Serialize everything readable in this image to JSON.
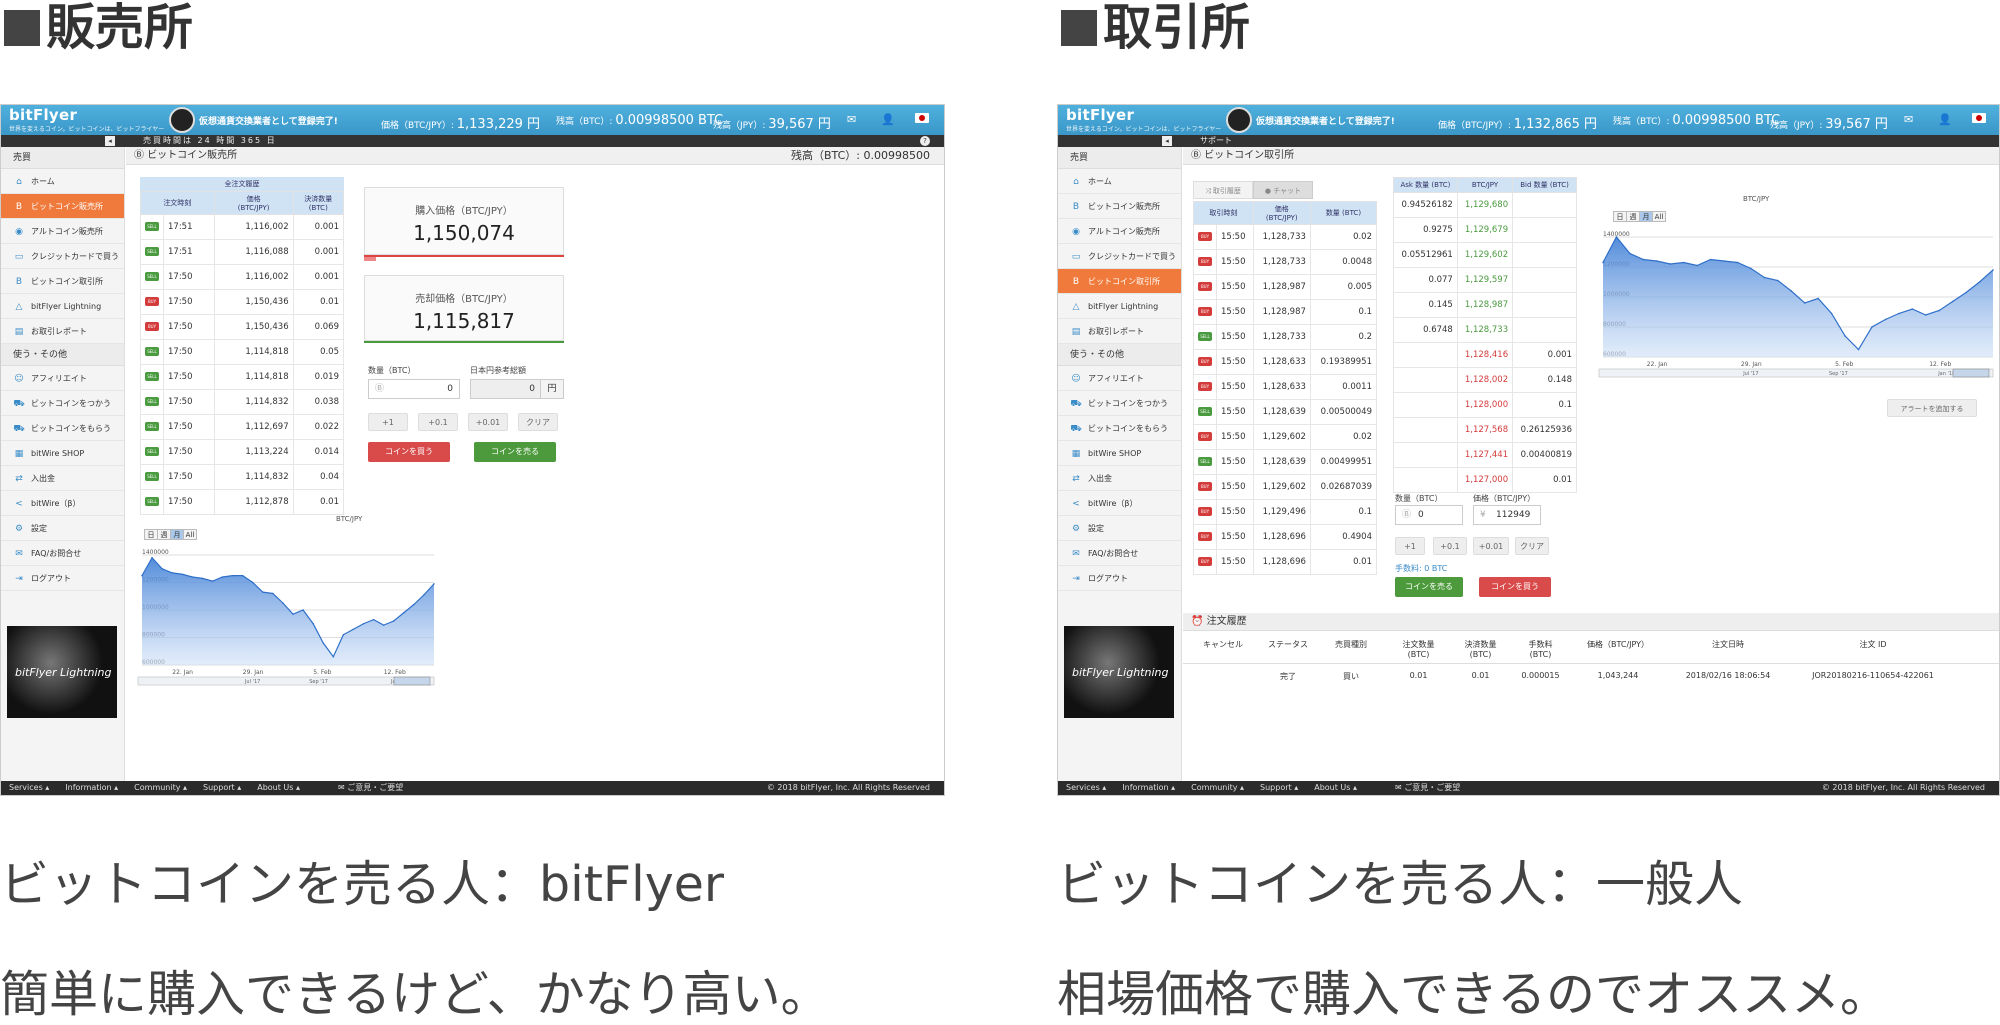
{
  "left": {
    "heading": "販売所",
    "caption1": "ビットコインを売る人：bitFlyer",
    "caption2": "簡単に購入できるけど、かなり高い。",
    "app": {
      "logo": "bitFlyer",
      "tagline": "世界を変えるコイン。ビットコインは、ビットフライヤー",
      "registered": "仮想通貨交換業者として登録完了!",
      "price_label": "価格（BTC/JPY）:",
      "price": "1,133,229 円",
      "btc_label": "残高（BTC）:",
      "btc": "0.00998500 BTC",
      "jpy_label": "残高（JPY）:",
      "jpy": "39,567 円",
      "notice": "売買時間は 24 時間 365 日",
      "page_title": "ビットコイン販売所",
      "balance": "残高（BTC）: 0.00998500"
    },
    "sidebar": {
      "section1": "売買",
      "items1": [
        {
          "label": "ホーム",
          "icon": "⌂"
        },
        {
          "label": "ビットコイン販売所",
          "icon": "B",
          "active": true
        },
        {
          "label": "アルトコイン販売所",
          "icon": "◉"
        },
        {
          "label": "クレジットカードで買う",
          "icon": "▭"
        },
        {
          "label": "ビットコイン取引所",
          "icon": "B"
        },
        {
          "label": "bitFlyer Lightning",
          "icon": "△"
        },
        {
          "label": "お取引レポート",
          "icon": "▤"
        }
      ],
      "section2": "使う・その他",
      "items2": [
        {
          "label": "アフィリエイト",
          "icon": "☺"
        },
        {
          "label": "ビットコインをつかう",
          "icon": "⛟"
        },
        {
          "label": "ビットコインをもらう",
          "icon": "⛟"
        },
        {
          "label": "bitWire SHOP",
          "icon": "▦"
        },
        {
          "label": "入出金",
          "icon": "⇄"
        },
        {
          "label": "bitWire（β）",
          "icon": "<"
        },
        {
          "label": "設定",
          "icon": "⚙"
        },
        {
          "label": "FAQ/お問合せ",
          "icon": "✉"
        },
        {
          "label": "ログアウト",
          "icon": "⇥"
        }
      ],
      "banner": "bitFlyer Lightning"
    },
    "trades": {
      "title": "全注文履歴",
      "headers": [
        "注文時刻",
        "価格\n(BTC/JPY)",
        "決済数量\n(BTC)"
      ],
      "rows": [
        {
          "side": "SELL",
          "time": "17:51",
          "price": "1,116,002",
          "qty": "0.001"
        },
        {
          "side": "SELL",
          "time": "17:51",
          "price": "1,116,088",
          "qty": "0.001"
        },
        {
          "side": "SELL",
          "time": "17:50",
          "price": "1,116,002",
          "qty": "0.001"
        },
        {
          "side": "BUY",
          "time": "17:50",
          "price": "1,150,436",
          "qty": "0.01"
        },
        {
          "side": "BUY",
          "time": "17:50",
          "price": "1,150,436",
          "qty": "0.069"
        },
        {
          "side": "SELL",
          "time": "17:50",
          "price": "1,114,818",
          "qty": "0.05"
        },
        {
          "side": "SELL",
          "time": "17:50",
          "price": "1,114,818",
          "qty": "0.019"
        },
        {
          "side": "SELL",
          "time": "17:50",
          "price": "1,114,832",
          "qty": "0.038"
        },
        {
          "side": "SELL",
          "time": "17:50",
          "price": "1,112,697",
          "qty": "0.022"
        },
        {
          "side": "SELL",
          "time": "17:50",
          "price": "1,113,224",
          "qty": "0.014"
        },
        {
          "side": "SELL",
          "time": "17:50",
          "price": "1,114,832",
          "qty": "0.04"
        },
        {
          "side": "SELL",
          "time": "17:50",
          "price": "1,112,878",
          "qty": "0.01"
        }
      ]
    },
    "buy_price_label": "購入価格（BTC/JPY）",
    "buy_price": "1,150,074",
    "sell_price_label": "売却価格（BTC/JPY）",
    "sell_price": "1,115,817",
    "qty_label": "数量（BTC）",
    "qty_value": "0",
    "yen_label": "日本円参考総額",
    "yen_value": "0",
    "yen_unit": "円",
    "steps": [
      "+1",
      "+0.1",
      "+0.01",
      "クリア"
    ],
    "buy_button": "コインを買う",
    "sell_button": "コインを売る",
    "chart_title": "BTC/JPY",
    "ranges": [
      "日",
      "週",
      "月",
      "All"
    ],
    "yticks": [
      "1400000",
      "1200000",
      "1000000",
      "800000",
      "600000"
    ],
    "xticks": [
      "22. Jan",
      "29. Jan",
      "5. Feb",
      "12. Feb"
    ],
    "nav_labels": [
      "Jul '17",
      "Sep '17",
      "Jan '18"
    ]
  },
  "right": {
    "heading": "取引所",
    "caption1": "ビットコインを売る人：一般人",
    "caption2": "相場価格で購入できるのでオススメ。",
    "app": {
      "price": "1,132,865 円",
      "page_title": "ビットコイン取引所",
      "support": "サポート"
    },
    "tabs": [
      "取引履歴",
      "チャット"
    ],
    "trades": {
      "headers": [
        "取引時刻",
        "価格\n(BTC/JPY)",
        "数量 (BTC)"
      ],
      "rows": [
        {
          "side": "BUY",
          "time": "15:50",
          "price": "1,128,733",
          "qty": "0.02"
        },
        {
          "side": "BUY",
          "time": "15:50",
          "price": "1,128,733",
          "qty": "0.0048"
        },
        {
          "side": "BUY",
          "time": "15:50",
          "price": "1,128,987",
          "qty": "0.005"
        },
        {
          "side": "BUY",
          "time": "15:50",
          "price": "1,128,987",
          "qty": "0.1"
        },
        {
          "side": "SELL",
          "time": "15:50",
          "price": "1,128,733",
          "qty": "0.2"
        },
        {
          "side": "BUY",
          "time": "15:50",
          "price": "1,128,633",
          "qty": "0.19389951"
        },
        {
          "side": "BUY",
          "time": "15:50",
          "price": "1,128,633",
          "qty": "0.0011"
        },
        {
          "side": "SELL",
          "time": "15:50",
          "price": "1,128,639",
          "qty": "0.00500049"
        },
        {
          "side": "BUY",
          "time": "15:50",
          "price": "1,129,602",
          "qty": "0.02"
        },
        {
          "side": "SELL",
          "time": "15:50",
          "price": "1,128,639",
          "qty": "0.00499951"
        },
        {
          "side": "BUY",
          "time": "15:50",
          "price": "1,129,602",
          "qty": "0.02687039"
        },
        {
          "side": "BUY",
          "time": "15:50",
          "price": "1,129,496",
          "qty": "0.1"
        },
        {
          "side": "BUY",
          "time": "15:50",
          "price": "1,128,696",
          "qty": "0.4904"
        },
        {
          "side": "BUY",
          "time": "15:50",
          "price": "1,128,696",
          "qty": "0.01"
        }
      ]
    },
    "book": {
      "headers": [
        "Ask 数量 (BTC)",
        "BTC/JPY",
        "Bid 数量 (BTC)"
      ],
      "rows": [
        {
          "ask": "0.94526182",
          "price": "1,129,680",
          "bid": "",
          "side": "ask"
        },
        {
          "ask": "0.9275",
          "price": "1,129,679",
          "bid": "",
          "side": "ask"
        },
        {
          "ask": "0.05512961",
          "price": "1,129,602",
          "bid": "",
          "side": "ask"
        },
        {
          "ask": "0.077",
          "price": "1,129,597",
          "bid": "",
          "side": "ask"
        },
        {
          "ask": "0.145",
          "price": "1,128,987",
          "bid": "",
          "side": "ask"
        },
        {
          "ask": "0.6748",
          "price": "1,128,733",
          "bid": "",
          "side": "ask"
        },
        {
          "ask": "",
          "price": "1,128,416",
          "bid": "0.001",
          "side": "bid"
        },
        {
          "ask": "",
          "price": "1,128,002",
          "bid": "0.148",
          "side": "bid"
        },
        {
          "ask": "",
          "price": "1,128,000",
          "bid": "0.1",
          "side": "bid"
        },
        {
          "ask": "",
          "price": "1,127,568",
          "bid": "0.26125936",
          "side": "bid"
        },
        {
          "ask": "",
          "price": "1,127,441",
          "bid": "0.00400819",
          "side": "bid"
        },
        {
          "ask": "",
          "price": "1,127,000",
          "bid": "0.01",
          "side": "bid"
        }
      ]
    },
    "qty_label": "数量（BTC）",
    "qty_value": "0",
    "price_label": "価格（BTC/JPY）",
    "price_value": "112949",
    "steps": [
      "+1",
      "+0.1",
      "+0.01",
      "クリア"
    ],
    "fee": "手数料: 0 BTC",
    "sell_button": "コインを売る",
    "buy_button": "コインを買う",
    "chart_title": "BTC/JPY",
    "alert_button": "アラートを追加する",
    "yticks": [
      "1400000",
      "1200000",
      "1000000",
      "800000",
      "600000"
    ],
    "xticks": [
      "22. Jan",
      "29. Jan",
      "5. Feb",
      "12. Feb"
    ],
    "nav_labels": [
      "Jul '17",
      "Sep '17",
      "Jan '18"
    ],
    "history": {
      "title": "注文履歴",
      "headers": [
        "キャンセル",
        "ステータス",
        "売買種別",
        "注文数量\n(BTC)",
        "決済数量\n(BTC)",
        "手数料\n(BTC)",
        "価格（BTC/JPY）",
        "注文日時",
        "注文 ID"
      ],
      "row": [
        "",
        "完了",
        "買い",
        "0.01",
        "0.01",
        "0.000015",
        "1,043,244",
        "2018/02/16 18:06:54",
        "JOR20180216-110654-422061"
      ]
    }
  },
  "footer": {
    "links": [
      "Services ▴",
      "Information ▴",
      "Community ▴",
      "Support ▴",
      "About Us ▴"
    ],
    "feedback": "✉ ご意見・ご要望",
    "copyright": "© 2018 bitFlyer, Inc. All Rights Reserved"
  },
  "chart_data": [
    {
      "type": "area",
      "title": "BTC/JPY",
      "x": [
        "18. Jan",
        "19. Jan",
        "20. Jan",
        "21. Jan",
        "22. Jan",
        "23. Jan",
        "24. Jan",
        "25. Jan",
        "26. Jan",
        "27. Jan",
        "28. Jan",
        "29. Jan",
        "30. Jan",
        "31. Jan",
        "1. Feb",
        "2. Feb",
        "3. Feb",
        "4. Feb",
        "5. Feb",
        "6. Feb",
        "7. Feb",
        "8. Feb",
        "9. Feb",
        "10. Feb",
        "11. Feb",
        "12. Feb",
        "13. Feb",
        "14. Feb",
        "15. Feb",
        "16. Feb"
      ],
      "values": [
        1250000,
        1380000,
        1300000,
        1270000,
        1260000,
        1240000,
        1230000,
        1210000,
        1240000,
        1250000,
        1250000,
        1200000,
        1130000,
        1120000,
        1050000,
        970000,
        1000000,
        900000,
        760000,
        660000,
        820000,
        860000,
        900000,
        930000,
        890000,
        920000,
        980000,
        1040000,
        1110000,
        1190000
      ],
      "ylim": [
        600000,
        1400000
      ]
    },
    {
      "type": "area",
      "title": "BTC/JPY",
      "x": [
        "18. Jan",
        "19. Jan",
        "20. Jan",
        "21. Jan",
        "22. Jan",
        "23. Jan",
        "24. Jan",
        "25. Jan",
        "26. Jan",
        "27. Jan",
        "28. Jan",
        "29. Jan",
        "30. Jan",
        "31. Jan",
        "1. Feb",
        "2. Feb",
        "3. Feb",
        "4. Feb",
        "5. Feb",
        "6. Feb",
        "7. Feb",
        "8. Feb",
        "9. Feb",
        "10. Feb",
        "11. Feb",
        "12. Feb",
        "13. Feb",
        "14. Feb",
        "15. Feb",
        "16. Feb"
      ],
      "values": [
        1230000,
        1400000,
        1290000,
        1250000,
        1240000,
        1220000,
        1230000,
        1210000,
        1250000,
        1240000,
        1230000,
        1190000,
        1130000,
        1110000,
        1040000,
        960000,
        990000,
        890000,
        740000,
        650000,
        800000,
        850000,
        890000,
        920000,
        880000,
        910000,
        970000,
        1030000,
        1100000,
        1180000
      ],
      "ylim": [
        600000,
        1400000
      ]
    }
  ]
}
